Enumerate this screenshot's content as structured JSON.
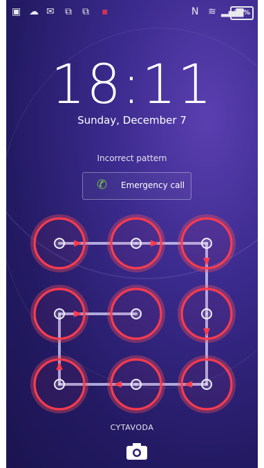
{
  "status_bar": {
    "icons": [
      "image-icon",
      "cloud-upload-icon",
      "gmail-icon",
      "screen-icon",
      "screen-icon",
      "app-icon",
      "nfc-icon",
      "wifi-icon",
      "signal-icon"
    ],
    "battery": "39%"
  },
  "clock": {
    "time": "18:11",
    "date": "Sunday, December 7"
  },
  "message": "Incorrect pattern",
  "emergency": {
    "label": "Emergency call",
    "icon": "phone-icon"
  },
  "owner": "CYTAVODA",
  "pattern": {
    "grid": "3x3",
    "error_color": "#ff3b4d",
    "path": [
      1,
      2,
      3,
      6,
      9,
      8,
      7,
      4,
      5
    ]
  },
  "camera": {
    "icon": "camera-icon"
  }
}
